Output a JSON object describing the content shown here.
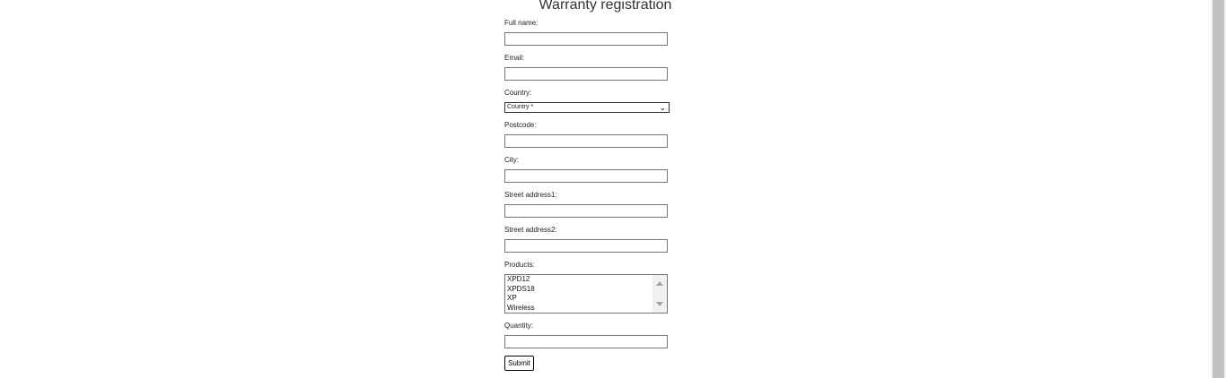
{
  "form": {
    "title": "Warranty registration",
    "labels": {
      "full_name": "Full name:",
      "email": "Email:",
      "country": "Country:",
      "postcode": "Postcode:",
      "city": "City:",
      "street1": "Street address1:",
      "street2": "Street address2:",
      "products": "Products:",
      "quantity": "Quantity:"
    },
    "values": {
      "full_name": "",
      "email": "",
      "postcode": "",
      "city": "",
      "street1": "",
      "street2": "",
      "quantity": ""
    },
    "country_selected": "Country *",
    "products_options": [
      "XPD12",
      "XPDS18",
      "XP",
      "Wireless"
    ],
    "submit_label": "Submit"
  },
  "icons": {
    "country_dropdown": "chevron-down-icon",
    "list_scroll_up": "triangle-up-icon",
    "list_scroll_down": "triangle-down-icon"
  }
}
